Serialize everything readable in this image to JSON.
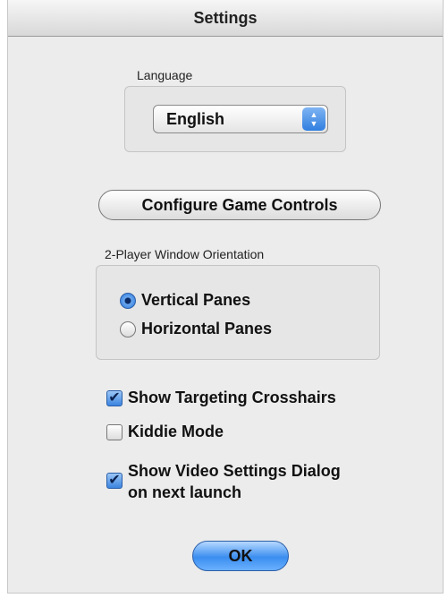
{
  "window": {
    "title": "Settings"
  },
  "language": {
    "group_label": "Language",
    "selected": "English"
  },
  "configure_controls_label": "Configure Game Controls",
  "orientation": {
    "group_label": "2-Player  Window Orientation",
    "options": [
      {
        "label": "Vertical Panes",
        "selected": true
      },
      {
        "label": "Horizontal Panes",
        "selected": false
      }
    ]
  },
  "checkboxes": [
    {
      "label": "Show Targeting Crosshairs",
      "checked": true
    },
    {
      "label": "Kiddie Mode",
      "checked": false
    },
    {
      "label": "Show Video Settings Dialog",
      "label2": "on next launch",
      "checked": true
    }
  ],
  "ok_label": "OK",
  "icons": {
    "popup_arrows": "updown-arrows-icon",
    "check": "checkmark-icon"
  },
  "colors": {
    "accent": "#3b8ef0",
    "background": "#ececec"
  }
}
